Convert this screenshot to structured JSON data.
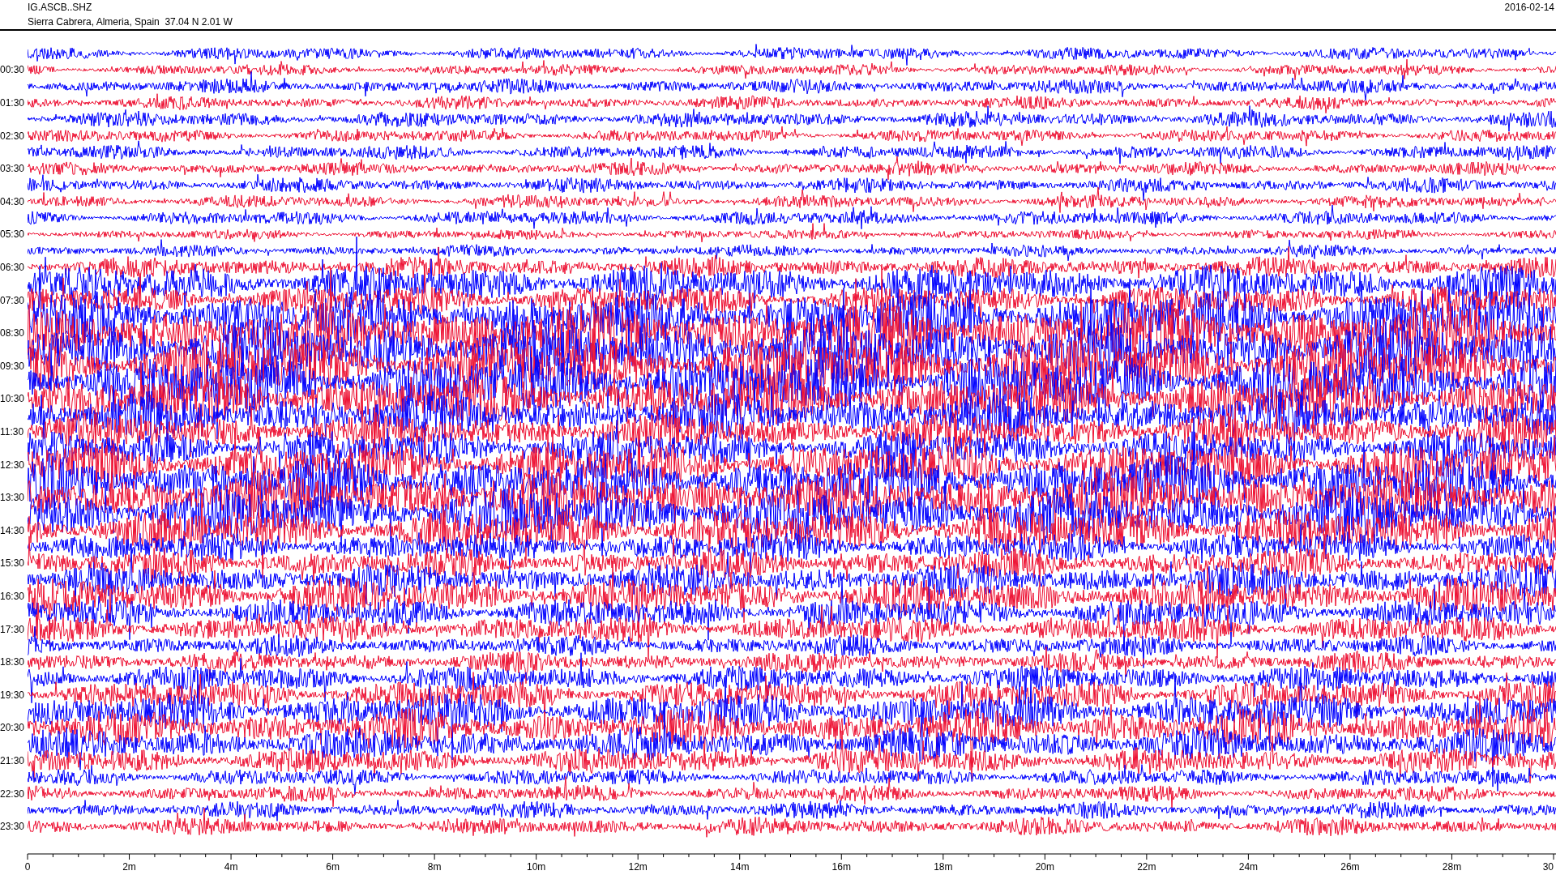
{
  "header": {
    "station_code": "IG.ASCB..SHZ",
    "location": "Sierra Cabrera, Almeria, Spain  37.04 N 2.01 W",
    "date": "2016-02-14"
  },
  "helicorder": {
    "row_labels": [
      "00:30",
      "01:30",
      "02:30",
      "03:30",
      "04:30",
      "05:30",
      "06:30",
      "07:30",
      "08:30",
      "09:30",
      "10:30",
      "11:30",
      "12:30",
      "13:30",
      "14:30",
      "15:30",
      "16:30",
      "17:30",
      "18:30",
      "19:30",
      "20:30",
      "21:30",
      "22:30",
      "23:30"
    ],
    "x_axis_labels": [
      "0",
      "2m",
      "4m",
      "6m",
      "8m",
      "10m",
      "12m",
      "14m",
      "16m",
      "18m",
      "20m",
      "22m",
      "24m",
      "26m",
      "28m",
      "30"
    ]
  }
}
